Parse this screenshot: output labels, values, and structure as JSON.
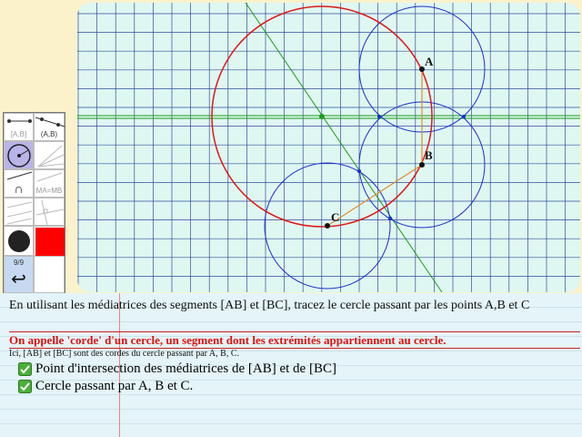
{
  "canvas": {
    "points": [
      {
        "id": "A",
        "label": "A"
      },
      {
        "id": "B",
        "label": "B"
      },
      {
        "id": "C",
        "label": "C"
      }
    ],
    "colors": {
      "background": "#dff7f1",
      "grid": "#2f4f9c",
      "main_circle": "#e01818",
      "aux_circles": "#1a2fcc",
      "bisector": "#1d9a1d",
      "segment": "#e08a2a",
      "point": "#111111"
    }
  },
  "toolbar": {
    "segment_label": "[A,B]",
    "line_label": "(A,B)",
    "intersection_label": "∩",
    "equidistant_label": "MA=MB",
    "page_counter": "9/9",
    "undo_icon": "↩",
    "colors": {
      "point_color": "#222222",
      "fill_color": "#ff0000"
    }
  },
  "notes": {
    "instruction": "En utilisant les médiatrices des segments [AB] et [BC], tracez le cercle passant par les points A,B et C",
    "definition": "On appelle 'corde' d'un cercle, un segment dont les extrémités appartiennent au cercle.",
    "remark": "Ici, [AB] et [BC] sont des cordes du cercle passant par A, B, C.",
    "tasks": [
      {
        "label": "Point d'intersection des médiatrices de [AB] et de [BC]",
        "done": true
      },
      {
        "label": "Cercle passant par A, B et C.",
        "done": true
      }
    ]
  }
}
